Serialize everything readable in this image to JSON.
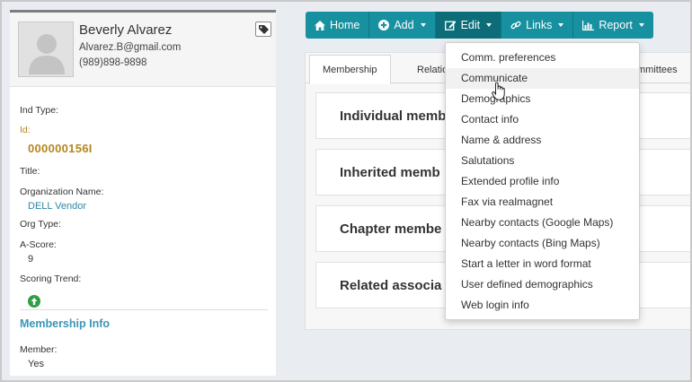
{
  "profile": {
    "name": "Beverly Alvarez",
    "email": "Alvarez.B@gmail.com",
    "phone": "(989)898-9898",
    "fields": {
      "ind_type_label": "Ind Type:",
      "id_label": "Id:",
      "id_value": "000000156I",
      "title_label": "Title:",
      "org_name_label": "Organization Name:",
      "org_name_value": "DELL Vendor",
      "org_type_label": "Org Type:",
      "ascore_label": "A-Score:",
      "ascore_value": "9",
      "trend_label": "Scoring Trend:"
    },
    "membership_section": "Membership Info",
    "member_label": "Member:",
    "member_value": "Yes"
  },
  "toolbar": {
    "home": "Home",
    "add": "Add",
    "edit": "Edit",
    "links": "Links",
    "report": "Report"
  },
  "tabs": {
    "membership": "Membership",
    "relations": "Relatio",
    "committees": "mmittees"
  },
  "cards": [
    "Individual memb",
    "Inherited memb",
    "Chapter membe",
    "Related associa"
  ],
  "edit_menu": [
    "Comm. preferences",
    "Communicate",
    "Demographics",
    "Contact info",
    "Name & address",
    "Salutations",
    "Extended profile info",
    "Fax via realmagnet",
    "Nearby contacts (Google Maps)",
    "Nearby contacts (Bing Maps)",
    "Start a letter in word format",
    "User defined demographics",
    "Web login info"
  ],
  "colors": {
    "toolbar": "#17909f",
    "toolbar_active": "#0c6d79",
    "id_gold": "#b58620",
    "link_blue": "#2d86a3",
    "trend_green": "#2f9e44"
  },
  "icons": {
    "home": "home-icon",
    "add": "plus-circle-icon",
    "edit": "edit-icon",
    "links": "link-icon",
    "report": "bar-chart-icon",
    "tag": "tag-icon",
    "trend": "arrow-up-circle-icon"
  }
}
